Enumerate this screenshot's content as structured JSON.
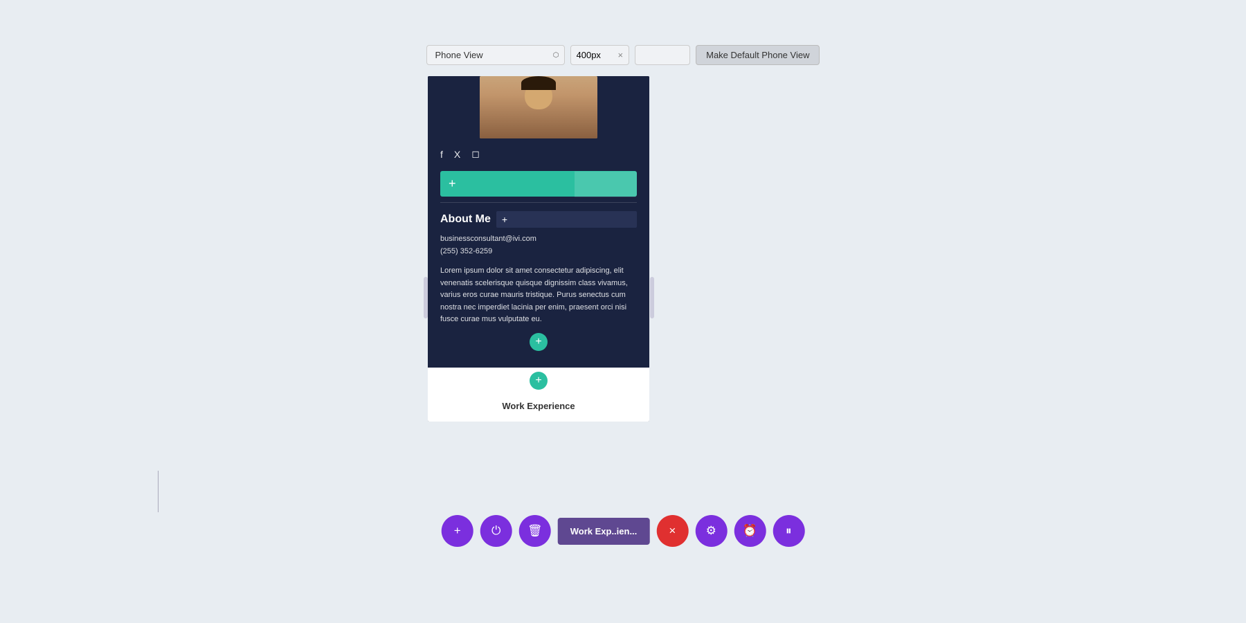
{
  "toolbar": {
    "view_selector_label": "Phone View",
    "px_value": "400px",
    "clear_label": "×",
    "extra_input_placeholder": "",
    "make_default_label": "Make Default Phone View"
  },
  "phone_preview": {
    "social_icons": [
      "f",
      "𝕏",
      "◻"
    ],
    "add_block_label": "+",
    "about_title": "About Me",
    "email": "businessconsultant@ivi.com",
    "phone": "(255) 352-6259",
    "bio": "Lorem ipsum dolor sit amet consectetur adipiscing, elit venenatis scelerisque quisque dignissim class vivamus, varius eros curae mauris tristique. Purus senectus cum nostra nec imperdiet lacinia per enim, praesent orci nisi fusce curae mus vulputate eu.",
    "add_section_label": "+",
    "add_between_label": "+",
    "work_section_label": "Work Experience"
  },
  "bottom_toolbar": {
    "add_label": "+",
    "power_label": "⏻",
    "trash_label": "🗑",
    "work_label": "Work Exp..ien...",
    "close_label": "×",
    "gear_label": "⚙",
    "clock_label": "⏰",
    "pause_label": "⏸"
  }
}
